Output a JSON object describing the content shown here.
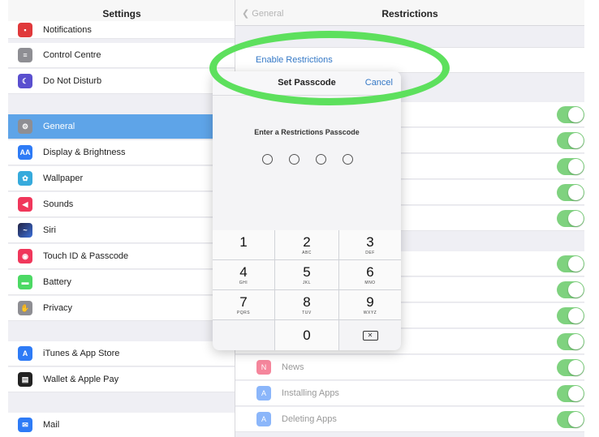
{
  "left": {
    "header": "Settings",
    "items": [
      {
        "label": "Notifications",
        "icon": "notifications-icon",
        "color": "#e0393b"
      },
      {
        "label": "Control Centre",
        "icon": "control-centre-icon",
        "color": "#8e8e93"
      },
      {
        "label": "Do Not Disturb",
        "icon": "moon-icon",
        "color": "#5a4fcf"
      },
      {
        "label": "General",
        "icon": "gear-icon",
        "color": "#8e8e93",
        "selected": true
      },
      {
        "label": "Display & Brightness",
        "icon": "display-icon",
        "color": "#2e7bf6"
      },
      {
        "label": "Wallpaper",
        "icon": "wallpaper-icon",
        "color": "#36aadc"
      },
      {
        "label": "Sounds",
        "icon": "speaker-icon",
        "color": "#f0375b"
      },
      {
        "label": "Siri",
        "icon": "siri-icon",
        "color": "#222244"
      },
      {
        "label": "Touch ID & Passcode",
        "icon": "fingerprint-icon",
        "color": "#f0375b"
      },
      {
        "label": "Battery",
        "icon": "battery-icon",
        "color": "#4cd964"
      },
      {
        "label": "Privacy",
        "icon": "hand-icon",
        "color": "#8e8e93"
      },
      {
        "label": "iTunes & App Store",
        "icon": "app-store-icon",
        "color": "#2e7bf6"
      },
      {
        "label": "Wallet & Apple Pay",
        "icon": "wallet-icon",
        "color": "#222222"
      },
      {
        "label": "Mail",
        "icon": "mail-icon",
        "color": "#2e7bf6"
      }
    ]
  },
  "right": {
    "back_label": "General",
    "title": "Restrictions",
    "enable_label": "Enable Restrictions",
    "rows": [
      {
        "label": "News",
        "icon": "news-icon",
        "color": "#f0375b"
      },
      {
        "label": "Installing Apps",
        "icon": "app-store-icon",
        "color": "#2e7bf6"
      },
      {
        "label": "Deleting Apps",
        "icon": "app-store-icon",
        "color": "#2e7bf6"
      }
    ],
    "toggle_color": "#7fd27f"
  },
  "dialog": {
    "title": "Set Passcode",
    "cancel": "Cancel",
    "prompt": "Enter a Restrictions Passcode",
    "keys": [
      {
        "num": "1",
        "letters": ""
      },
      {
        "num": "2",
        "letters": "ABC"
      },
      {
        "num": "3",
        "letters": "DEF"
      },
      {
        "num": "4",
        "letters": "GHI"
      },
      {
        "num": "5",
        "letters": "JKL"
      },
      {
        "num": "6",
        "letters": "MNO"
      },
      {
        "num": "7",
        "letters": "PQRS"
      },
      {
        "num": "8",
        "letters": "TUV"
      },
      {
        "num": "9",
        "letters": "WXYZ"
      },
      {
        "num": "0",
        "letters": ""
      }
    ],
    "delete_glyph": "✕"
  },
  "highlight_color": "#5de05d"
}
